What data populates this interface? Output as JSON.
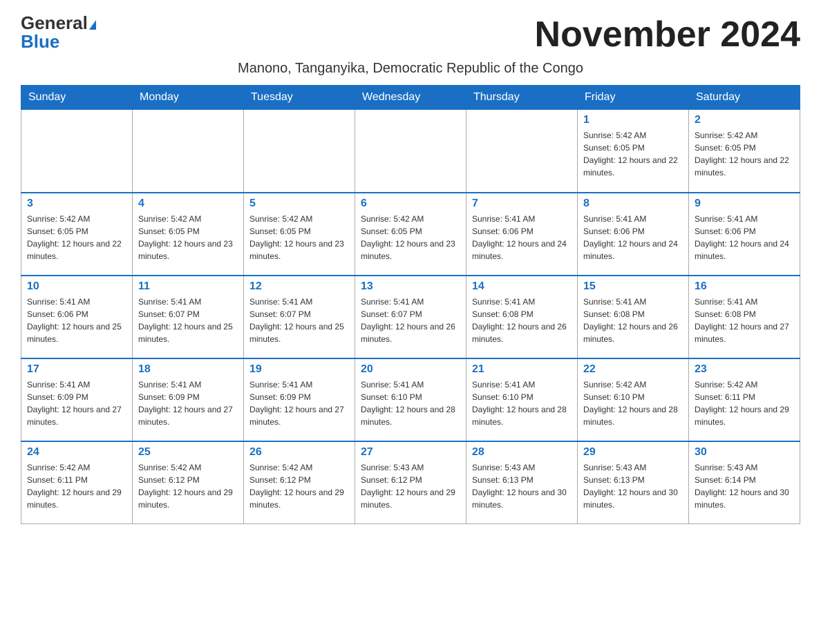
{
  "header": {
    "logo_general": "General",
    "logo_blue": "Blue",
    "month_title": "November 2024",
    "subtitle": "Manono, Tanganyika, Democratic Republic of the Congo"
  },
  "days_of_week": [
    "Sunday",
    "Monday",
    "Tuesday",
    "Wednesday",
    "Thursday",
    "Friday",
    "Saturday"
  ],
  "weeks": [
    [
      {
        "day": "",
        "info": ""
      },
      {
        "day": "",
        "info": ""
      },
      {
        "day": "",
        "info": ""
      },
      {
        "day": "",
        "info": ""
      },
      {
        "day": "",
        "info": ""
      },
      {
        "day": "1",
        "info": "Sunrise: 5:42 AM\nSunset: 6:05 PM\nDaylight: 12 hours and 22 minutes."
      },
      {
        "day": "2",
        "info": "Sunrise: 5:42 AM\nSunset: 6:05 PM\nDaylight: 12 hours and 22 minutes."
      }
    ],
    [
      {
        "day": "3",
        "info": "Sunrise: 5:42 AM\nSunset: 6:05 PM\nDaylight: 12 hours and 22 minutes."
      },
      {
        "day": "4",
        "info": "Sunrise: 5:42 AM\nSunset: 6:05 PM\nDaylight: 12 hours and 23 minutes."
      },
      {
        "day": "5",
        "info": "Sunrise: 5:42 AM\nSunset: 6:05 PM\nDaylight: 12 hours and 23 minutes."
      },
      {
        "day": "6",
        "info": "Sunrise: 5:42 AM\nSunset: 6:05 PM\nDaylight: 12 hours and 23 minutes."
      },
      {
        "day": "7",
        "info": "Sunrise: 5:41 AM\nSunset: 6:06 PM\nDaylight: 12 hours and 24 minutes."
      },
      {
        "day": "8",
        "info": "Sunrise: 5:41 AM\nSunset: 6:06 PM\nDaylight: 12 hours and 24 minutes."
      },
      {
        "day": "9",
        "info": "Sunrise: 5:41 AM\nSunset: 6:06 PM\nDaylight: 12 hours and 24 minutes."
      }
    ],
    [
      {
        "day": "10",
        "info": "Sunrise: 5:41 AM\nSunset: 6:06 PM\nDaylight: 12 hours and 25 minutes."
      },
      {
        "day": "11",
        "info": "Sunrise: 5:41 AM\nSunset: 6:07 PM\nDaylight: 12 hours and 25 minutes."
      },
      {
        "day": "12",
        "info": "Sunrise: 5:41 AM\nSunset: 6:07 PM\nDaylight: 12 hours and 25 minutes."
      },
      {
        "day": "13",
        "info": "Sunrise: 5:41 AM\nSunset: 6:07 PM\nDaylight: 12 hours and 26 minutes."
      },
      {
        "day": "14",
        "info": "Sunrise: 5:41 AM\nSunset: 6:08 PM\nDaylight: 12 hours and 26 minutes."
      },
      {
        "day": "15",
        "info": "Sunrise: 5:41 AM\nSunset: 6:08 PM\nDaylight: 12 hours and 26 minutes."
      },
      {
        "day": "16",
        "info": "Sunrise: 5:41 AM\nSunset: 6:08 PM\nDaylight: 12 hours and 27 minutes."
      }
    ],
    [
      {
        "day": "17",
        "info": "Sunrise: 5:41 AM\nSunset: 6:09 PM\nDaylight: 12 hours and 27 minutes."
      },
      {
        "day": "18",
        "info": "Sunrise: 5:41 AM\nSunset: 6:09 PM\nDaylight: 12 hours and 27 minutes."
      },
      {
        "day": "19",
        "info": "Sunrise: 5:41 AM\nSunset: 6:09 PM\nDaylight: 12 hours and 27 minutes."
      },
      {
        "day": "20",
        "info": "Sunrise: 5:41 AM\nSunset: 6:10 PM\nDaylight: 12 hours and 28 minutes."
      },
      {
        "day": "21",
        "info": "Sunrise: 5:41 AM\nSunset: 6:10 PM\nDaylight: 12 hours and 28 minutes."
      },
      {
        "day": "22",
        "info": "Sunrise: 5:42 AM\nSunset: 6:10 PM\nDaylight: 12 hours and 28 minutes."
      },
      {
        "day": "23",
        "info": "Sunrise: 5:42 AM\nSunset: 6:11 PM\nDaylight: 12 hours and 29 minutes."
      }
    ],
    [
      {
        "day": "24",
        "info": "Sunrise: 5:42 AM\nSunset: 6:11 PM\nDaylight: 12 hours and 29 minutes."
      },
      {
        "day": "25",
        "info": "Sunrise: 5:42 AM\nSunset: 6:12 PM\nDaylight: 12 hours and 29 minutes."
      },
      {
        "day": "26",
        "info": "Sunrise: 5:42 AM\nSunset: 6:12 PM\nDaylight: 12 hours and 29 minutes."
      },
      {
        "day": "27",
        "info": "Sunrise: 5:43 AM\nSunset: 6:12 PM\nDaylight: 12 hours and 29 minutes."
      },
      {
        "day": "28",
        "info": "Sunrise: 5:43 AM\nSunset: 6:13 PM\nDaylight: 12 hours and 30 minutes."
      },
      {
        "day": "29",
        "info": "Sunrise: 5:43 AM\nSunset: 6:13 PM\nDaylight: 12 hours and 30 minutes."
      },
      {
        "day": "30",
        "info": "Sunrise: 5:43 AM\nSunset: 6:14 PM\nDaylight: 12 hours and 30 minutes."
      }
    ]
  ]
}
